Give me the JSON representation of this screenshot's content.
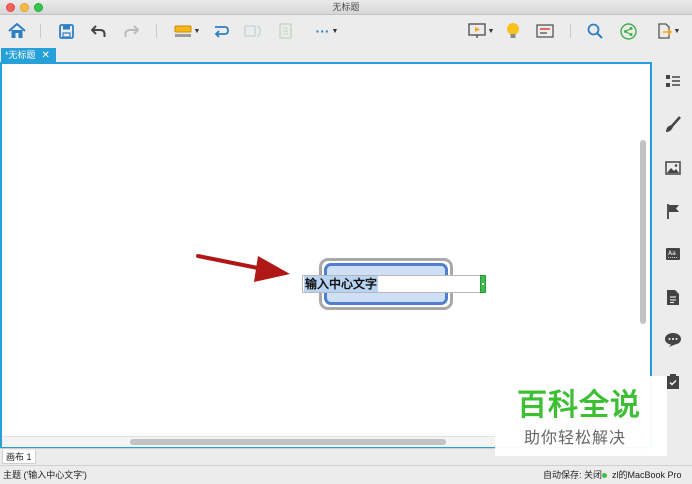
{
  "window": {
    "title": "无标题"
  },
  "tabs": [
    {
      "label": "*无标题",
      "close": "✕"
    }
  ],
  "toolbar": {
    "more_label": "···"
  },
  "topic": {
    "text": "输入中心文字"
  },
  "sheet": {
    "label": "画布 1"
  },
  "status": {
    "left": "主题 ('输入中心文字')",
    "autosave": "自动保存: 关闭",
    "device": "zl的MacBook Pro"
  },
  "watermark": {
    "main": "百科全说",
    "sub": "助你轻松解决"
  },
  "colors": {
    "accent": "#26a0d8",
    "topic_border": "#4f7fd0",
    "topic_fill": "#cfe0f6",
    "arrow": "#b01818",
    "watermark_green": "#3cbf33"
  },
  "icons": {
    "toolbar": [
      "home-icon",
      "save-icon",
      "undo-icon",
      "redo-icon",
      "topic-insert-icon",
      "relationship-icon",
      "summary-icon",
      "boundary-icon",
      "more-icon",
      "presentation-icon",
      "idea-bulb-icon",
      "notes-icon",
      "search-icon",
      "share-icon",
      "export-icon"
    ],
    "right_panel": [
      "outline-icon",
      "format-brush-icon",
      "image-icon",
      "flag-marker-icon",
      "text-style-icon",
      "note-icon",
      "comment-icon",
      "task-icon"
    ]
  }
}
